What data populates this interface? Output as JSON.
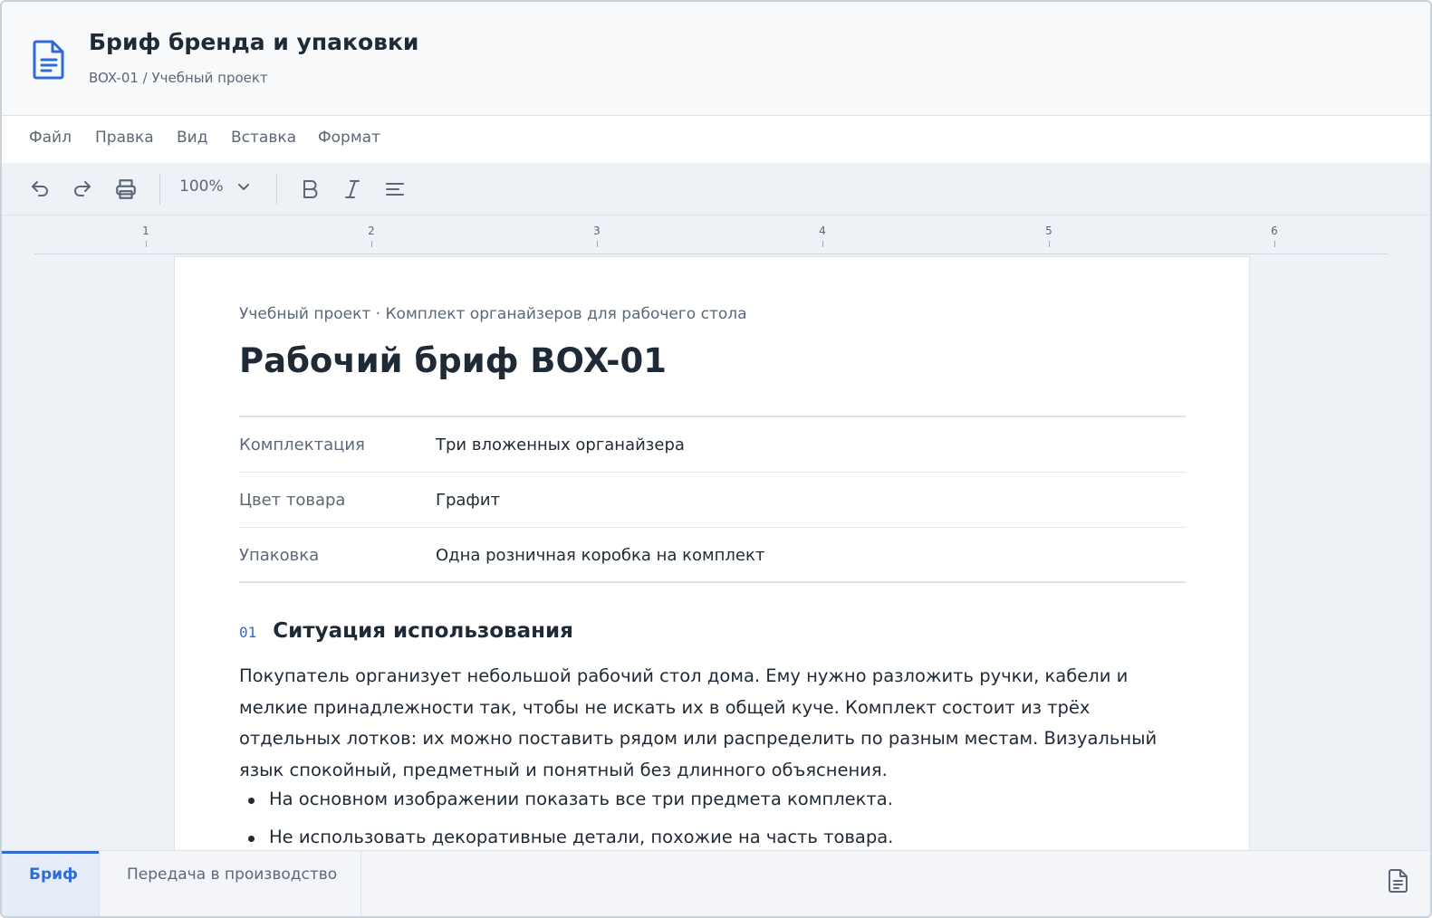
{
  "header": {
    "title": "Бриф бренда и упаковки",
    "breadcrumb": "BOX-01 / Учебный проект",
    "icon": "document-icon"
  },
  "menu": {
    "items": [
      "Файл",
      "Правка",
      "Вид",
      "Вставка",
      "Формат"
    ]
  },
  "toolbar": {
    "zoom": "100%",
    "icons": [
      "undo-icon",
      "redo-icon",
      "print-icon",
      "chevron-down-icon",
      "bold-icon",
      "italic-icon",
      "align-left-icon"
    ]
  },
  "ruler": {
    "numbers": [
      "1",
      "2",
      "3",
      "4",
      "5",
      "6"
    ]
  },
  "document": {
    "eyebrow": "Учебный проект · Комплект органайзеров для рабочего стола",
    "title": "Рабочий бриф BOX-01",
    "specs": [
      {
        "key": "Комплектация",
        "value": "Три вложенных органайзера"
      },
      {
        "key": "Цвет товара",
        "value": "Графит"
      },
      {
        "key": "Упаковка",
        "value": "Одна розничная коробка на комплект"
      }
    ],
    "section": {
      "number": "01",
      "title": "Ситуация использования",
      "paragraph": "Покупатель организует небольшой рабочий стол дома. Ему нужно разложить ручки, кабели и мелкие принадлежности так, чтобы не искать их в общей куче. Комплект состоит из трёх отдельных лотков: их можно поставить рядом или распределить по разным местам. Визуальный язык спокойный, предметный и понятный без длинного объяснения.",
      "bullets": [
        "На основном изображении показать все три предмета комплекта.",
        "Не использовать декоративные детали, похожие на часть товара."
      ]
    }
  },
  "tabs": {
    "items": [
      "Бриф",
      "Передача в производство"
    ],
    "active": "Бриф"
  },
  "colors": {
    "accent": "#2f6bd6",
    "text": "#1f2a37",
    "muted": "#5b6878"
  }
}
